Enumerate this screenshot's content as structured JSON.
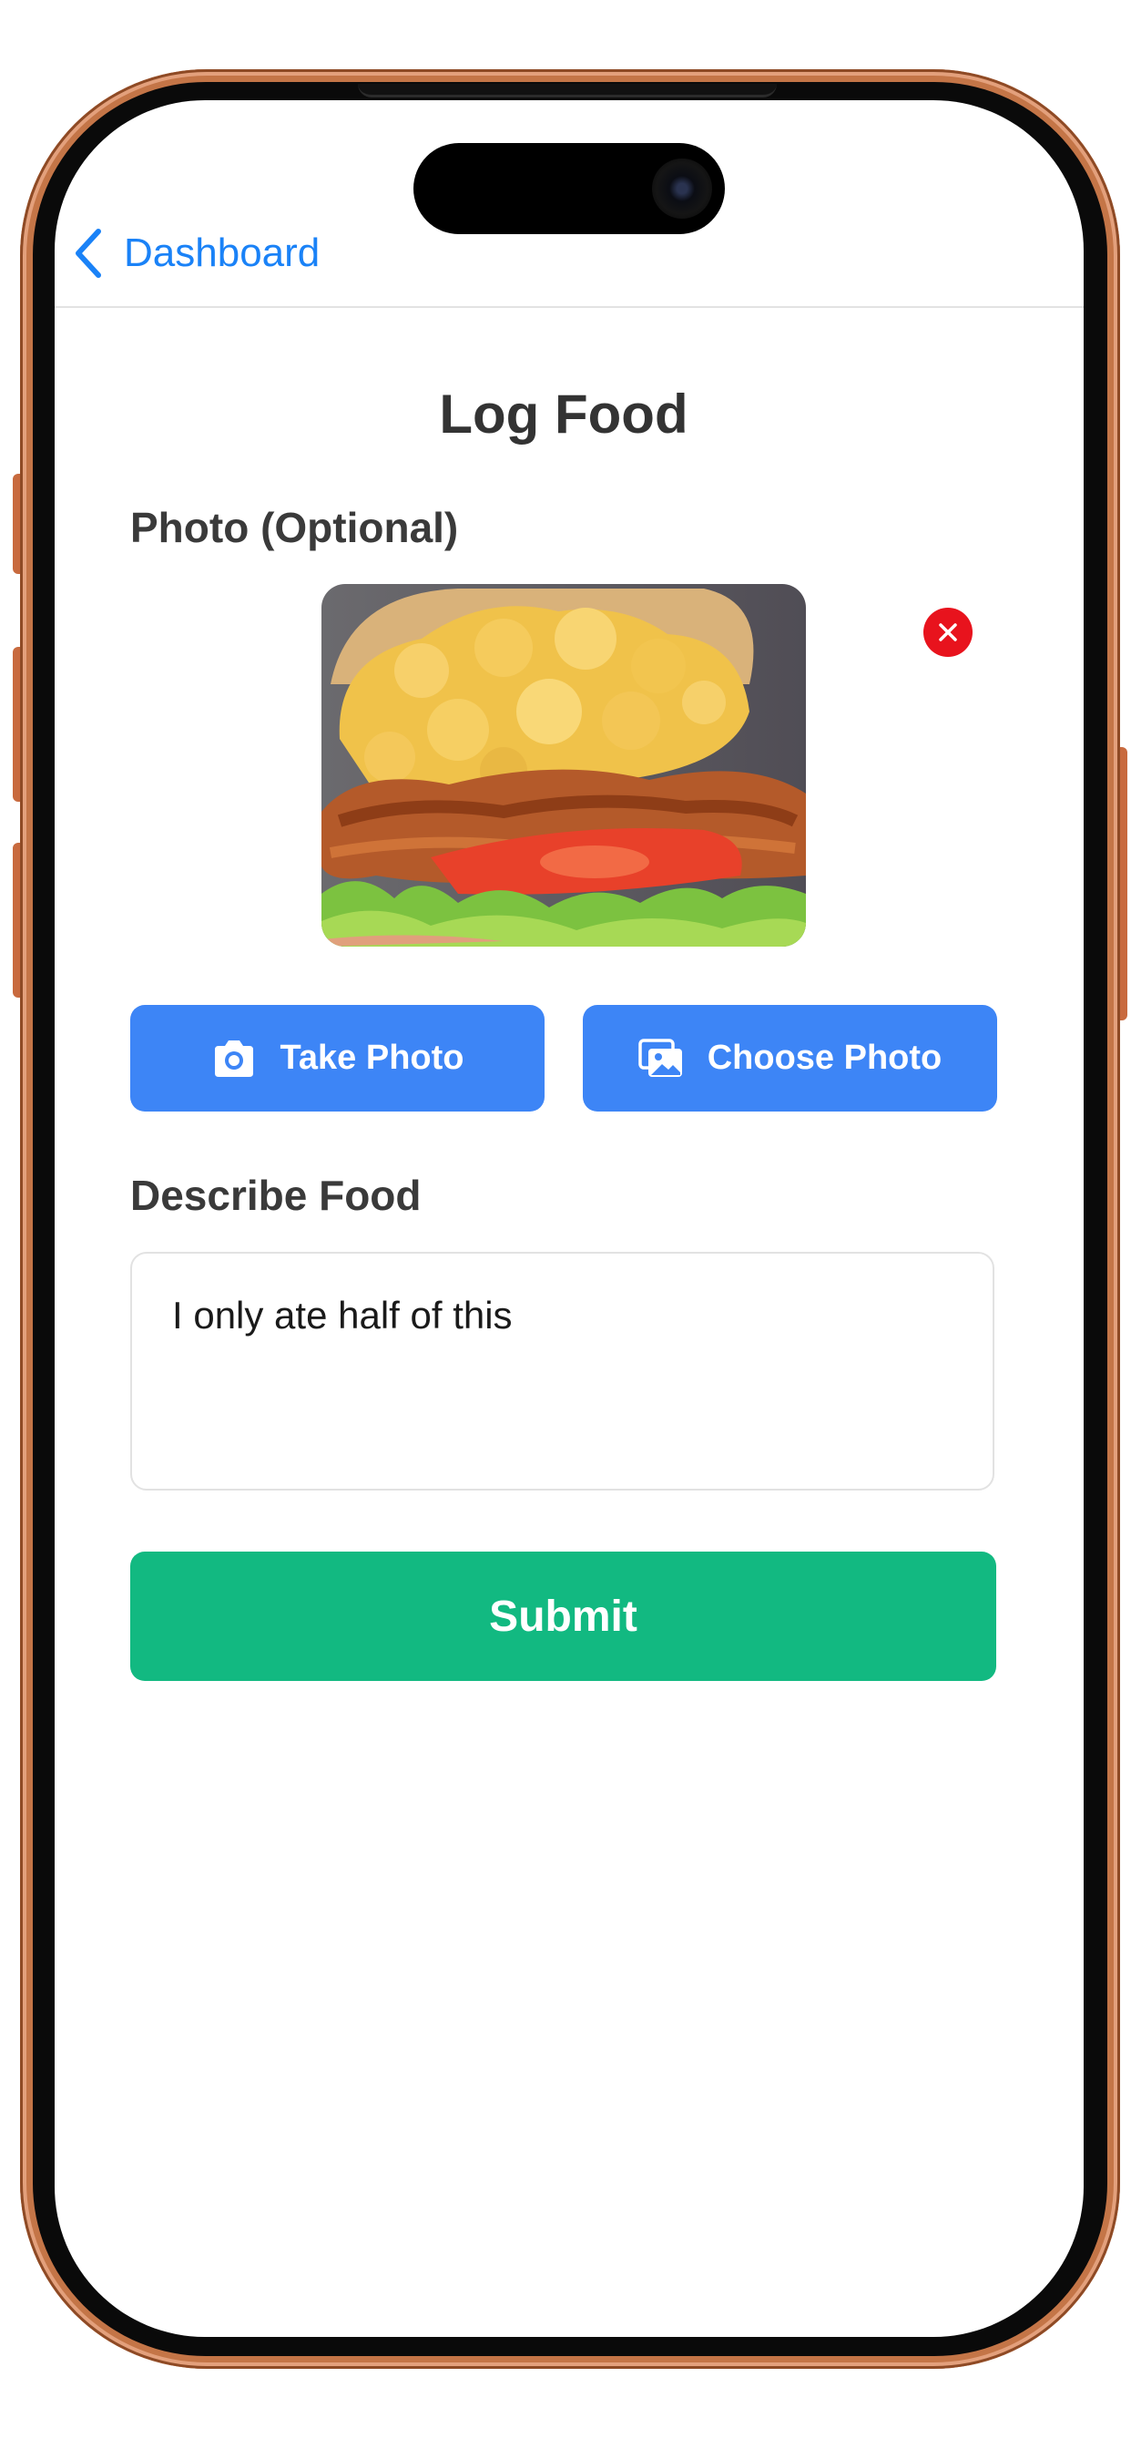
{
  "nav": {
    "back_label": "Dashboard"
  },
  "page": {
    "title": "Log Food"
  },
  "photo_section": {
    "label": "Photo (Optional)",
    "take_photo_label": "Take Photo",
    "choose_photo_label": "Choose Photo"
  },
  "describe_section": {
    "label": "Describe Food",
    "value": "I only ate half of this"
  },
  "submit_label": "Submit",
  "colors": {
    "accent_blue": "#3d85f6",
    "link_blue": "#1a82f7",
    "submit_green": "#12b981",
    "remove_red": "#e8131d",
    "frame_copper": "#c47547"
  },
  "icons": [
    "chevron-left-icon",
    "close-icon",
    "camera-icon",
    "photo-library-icon"
  ]
}
